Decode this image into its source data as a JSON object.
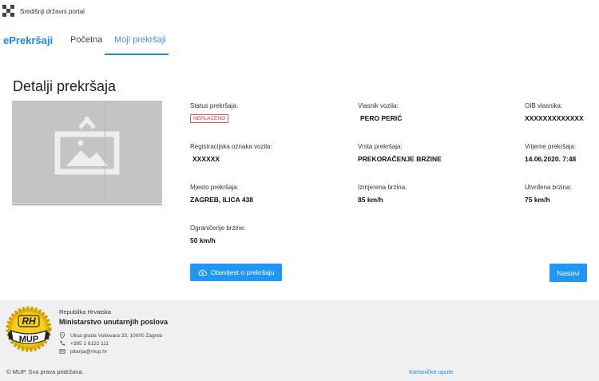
{
  "topbar": {
    "portal_name": "Središnji državni portal",
    "logo_icon": "checker-logo-icon"
  },
  "navbar": {
    "brand": "ePrekršaji",
    "links": [
      {
        "label": "Početna",
        "active": false
      },
      {
        "label": "Moji prekršaji",
        "active": true
      }
    ],
    "accent_color": "#1e88e5"
  },
  "details": {
    "title": "Detalji prekršaja",
    "image_icon": "image-placeholder-icon",
    "fields": {
      "status": {
        "label": "Status prekršaja:",
        "badge": "NEPLAĆENO",
        "badge_color": "#d83030"
      },
      "owner": {
        "label": "Vlasnik vozila:",
        "value": "PERO PERIĆ"
      },
      "oib": {
        "label": "OIB vlasnika:",
        "value": "XXXXXXXXXXXXX"
      },
      "plate": {
        "label": "Registracijska oznaka vozila:",
        "value": "XXXXXX"
      },
      "type": {
        "label": "Vrsta prekršaja:",
        "value": "PREKORAČENJE BRZINE"
      },
      "time": {
        "label": "Vrijeme prekršaja:",
        "value": "14.06.2020. 7:48"
      },
      "place": {
        "label": "Mjesto prekršaja:",
        "value": "ZAGREB, ILICA 438"
      },
      "measured": {
        "label": "Izmjerena brzina:",
        "value": "85 km/h"
      },
      "confirmed": {
        "label": "Utvrđena brzina:",
        "value": "75 km/h"
      },
      "limit": {
        "label": "Ograničenje brzine:",
        "value": "50 km/h"
      }
    },
    "notice_button": "Obavijest o prekršaju",
    "notice_icon": "cloud-download-icon",
    "next_button": "Nastavi",
    "button_color": "#2196f3"
  },
  "footer": {
    "logo_text": "MUP",
    "logo_icon": "mup-emblem-icon",
    "republic": "Republika Hrvatska",
    "ministry": "Ministarstvo unutarnjih poslova",
    "address": "Ulica grada Vukovara 33, 10000 Zagreb",
    "phone": "+385 1 6122 111",
    "email": "pitanja@mup.hr",
    "copyright": "© MUP. Sva prava pridržana.",
    "guide_link": "Korisničke upute"
  }
}
